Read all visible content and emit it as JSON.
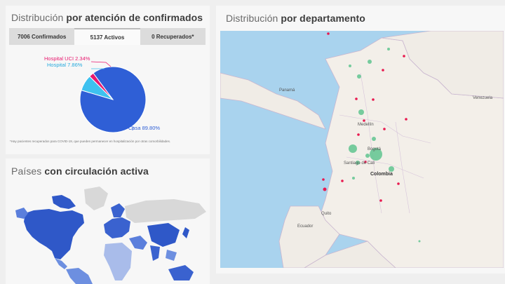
{
  "atencion": {
    "title_prefix": "Distribución",
    "title_bold": "por atención de confirmados",
    "tabs": [
      {
        "label": "7006 Confirmados",
        "active": false
      },
      {
        "label": "5137 Activos",
        "active": true
      },
      {
        "label": "0 Recuperados*",
        "active": false
      }
    ],
    "footnote": "*Hay pacientes recuperados para COVID-19, que pueden permanecer en hospitalización por otras comorbilidades.",
    "colors": {
      "casa": "#2f5fd6",
      "hospital": "#3ec1ef",
      "uci": "#e8196f"
    }
  },
  "chart_data": {
    "type": "pie",
    "slices": [
      {
        "label": "Casa 89.80%",
        "value": 89.8,
        "color": "#2f5fd6"
      },
      {
        "label": "Hospital 7.86%",
        "value": 7.86,
        "color": "#3ec1ef"
      },
      {
        "label": "Hospital UCI 2.34%",
        "value": 2.34,
        "color": "#e8196f"
      }
    ]
  },
  "paises": {
    "title_prefix": "Países",
    "title_bold": "con circulación activa"
  },
  "departamento": {
    "title_prefix": "Distribución",
    "title_bold": "por departamento",
    "map_labels": {
      "venezuela": "Venezuela",
      "colombia": "Colombia",
      "ecuador": "Ecuador",
      "bogota": "Bogotá",
      "medellin": "Medellín",
      "cali": "Santiago de Cali",
      "panama": "Panamá",
      "quito": "Quito"
    }
  }
}
